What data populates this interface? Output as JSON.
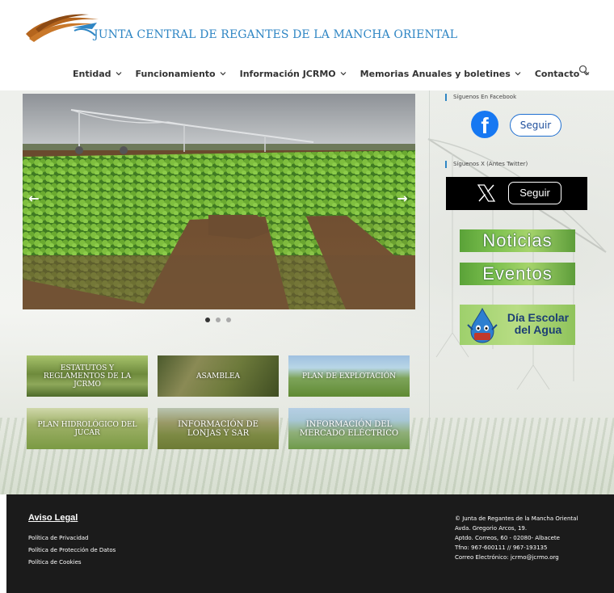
{
  "header": {
    "site_name": "JUNTA CENTRAL DE REGANTES DE LA MANCHA ORIENTAL",
    "nav": [
      {
        "label": "Entidad"
      },
      {
        "label": "Funcionamiento"
      },
      {
        "label": "Información JCRMO"
      },
      {
        "label": "Memorias Anuales y boletines"
      },
      {
        "label": "Contacto"
      }
    ],
    "search_icon": "search-icon"
  },
  "slider": {
    "image": "center-pivot irrigation over lettuce field",
    "slide_count": 3,
    "active_slide": 1
  },
  "tiles": [
    {
      "label": "ESTATUTOS Y REGLAMENTOS DE LA JCRMO"
    },
    {
      "label": "ASAMBLEA"
    },
    {
      "label": "PLAN DE EXPLOTACIÓN"
    },
    {
      "label": "PLAN HIDROLÓGICO DEL JUCAR"
    },
    {
      "label": "INFORMACIÓN DE LONJAS Y SAR"
    },
    {
      "label": "INFORMACIÓN DEL MERCADO ELÉCTRICO"
    }
  ],
  "sidebar": {
    "facebook_heading": "Síguenos En Facebook",
    "facebook_follow": "Seguir",
    "x_heading": "Síguenos X (Antes Twitter)",
    "x_follow": "Seguir",
    "noticias": "Noticias",
    "eventos": "Eventos",
    "dia_escolar": "Día Escolar del Agua",
    "dia_line1": "Día Escolar",
    "dia_line2": "del Agua"
  },
  "footer": {
    "aviso_legal": "Aviso Legal",
    "links": [
      "Política de Privacidad",
      "Política de Protección de Datos",
      "Política de Cookies"
    ],
    "copyright": "© Junta de Regantes de la Mancha Oriental",
    "address1": "Avda. Gregorio Arcos, 19.",
    "address2": "Aptdo. Correos, 60 - 02080- Albacete",
    "phone": "Tfno: 967-600111 // 967-193135",
    "email": "Correo Electrónico: jcrmo@jcrmo.org"
  },
  "colors": {
    "brand_blue": "#2f86c4",
    "footer_bg": "#1b1b1b",
    "facebook_blue": "#1778f2",
    "banner_green": "#7cc04e"
  }
}
